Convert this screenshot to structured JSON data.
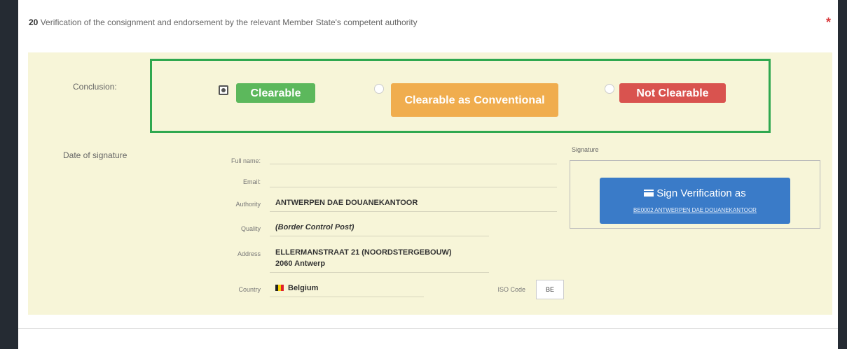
{
  "section": {
    "number": "20",
    "title": "Verification of the consignment and endorsement by the relevant Member State's competent authority",
    "required_mark": "*"
  },
  "conclusion": {
    "label": "Conclusion:",
    "options": [
      {
        "label": "Clearable",
        "selected": true,
        "color": "#5cb85c"
      },
      {
        "label": "Clearable as Conventional",
        "selected": false,
        "color": "#f0ad4e"
      },
      {
        "label": "Not Clearable",
        "selected": false,
        "color": "#d9534f"
      }
    ]
  },
  "date_of_signature": {
    "label": "Date of signature"
  },
  "fields": {
    "full_name": {
      "label": "Full name:",
      "value": ""
    },
    "email": {
      "label": "Email:",
      "value": ""
    },
    "authority": {
      "label": "Authority",
      "value": "ANTWERPEN DAE DOUANEKANTOOR"
    },
    "quality": {
      "label": "Quality",
      "value": "(Border Control Post)"
    },
    "address": {
      "label": "Address",
      "line1": "ELLERMANSTRAAT 21 (NOORDSTERGEBOUW)",
      "line2": "2060 Antwerp"
    },
    "country": {
      "label": "Country",
      "value": "Belgium"
    },
    "iso": {
      "label": "ISO Code",
      "value": "BE"
    }
  },
  "signature": {
    "label": "Signature",
    "button_label": "Sign Verification as",
    "button_sub": "BE0002 ANTWERPEN DAE DOUANEKANTOOR",
    "icon": "credit-card-icon",
    "color": "#3a7bc8"
  }
}
